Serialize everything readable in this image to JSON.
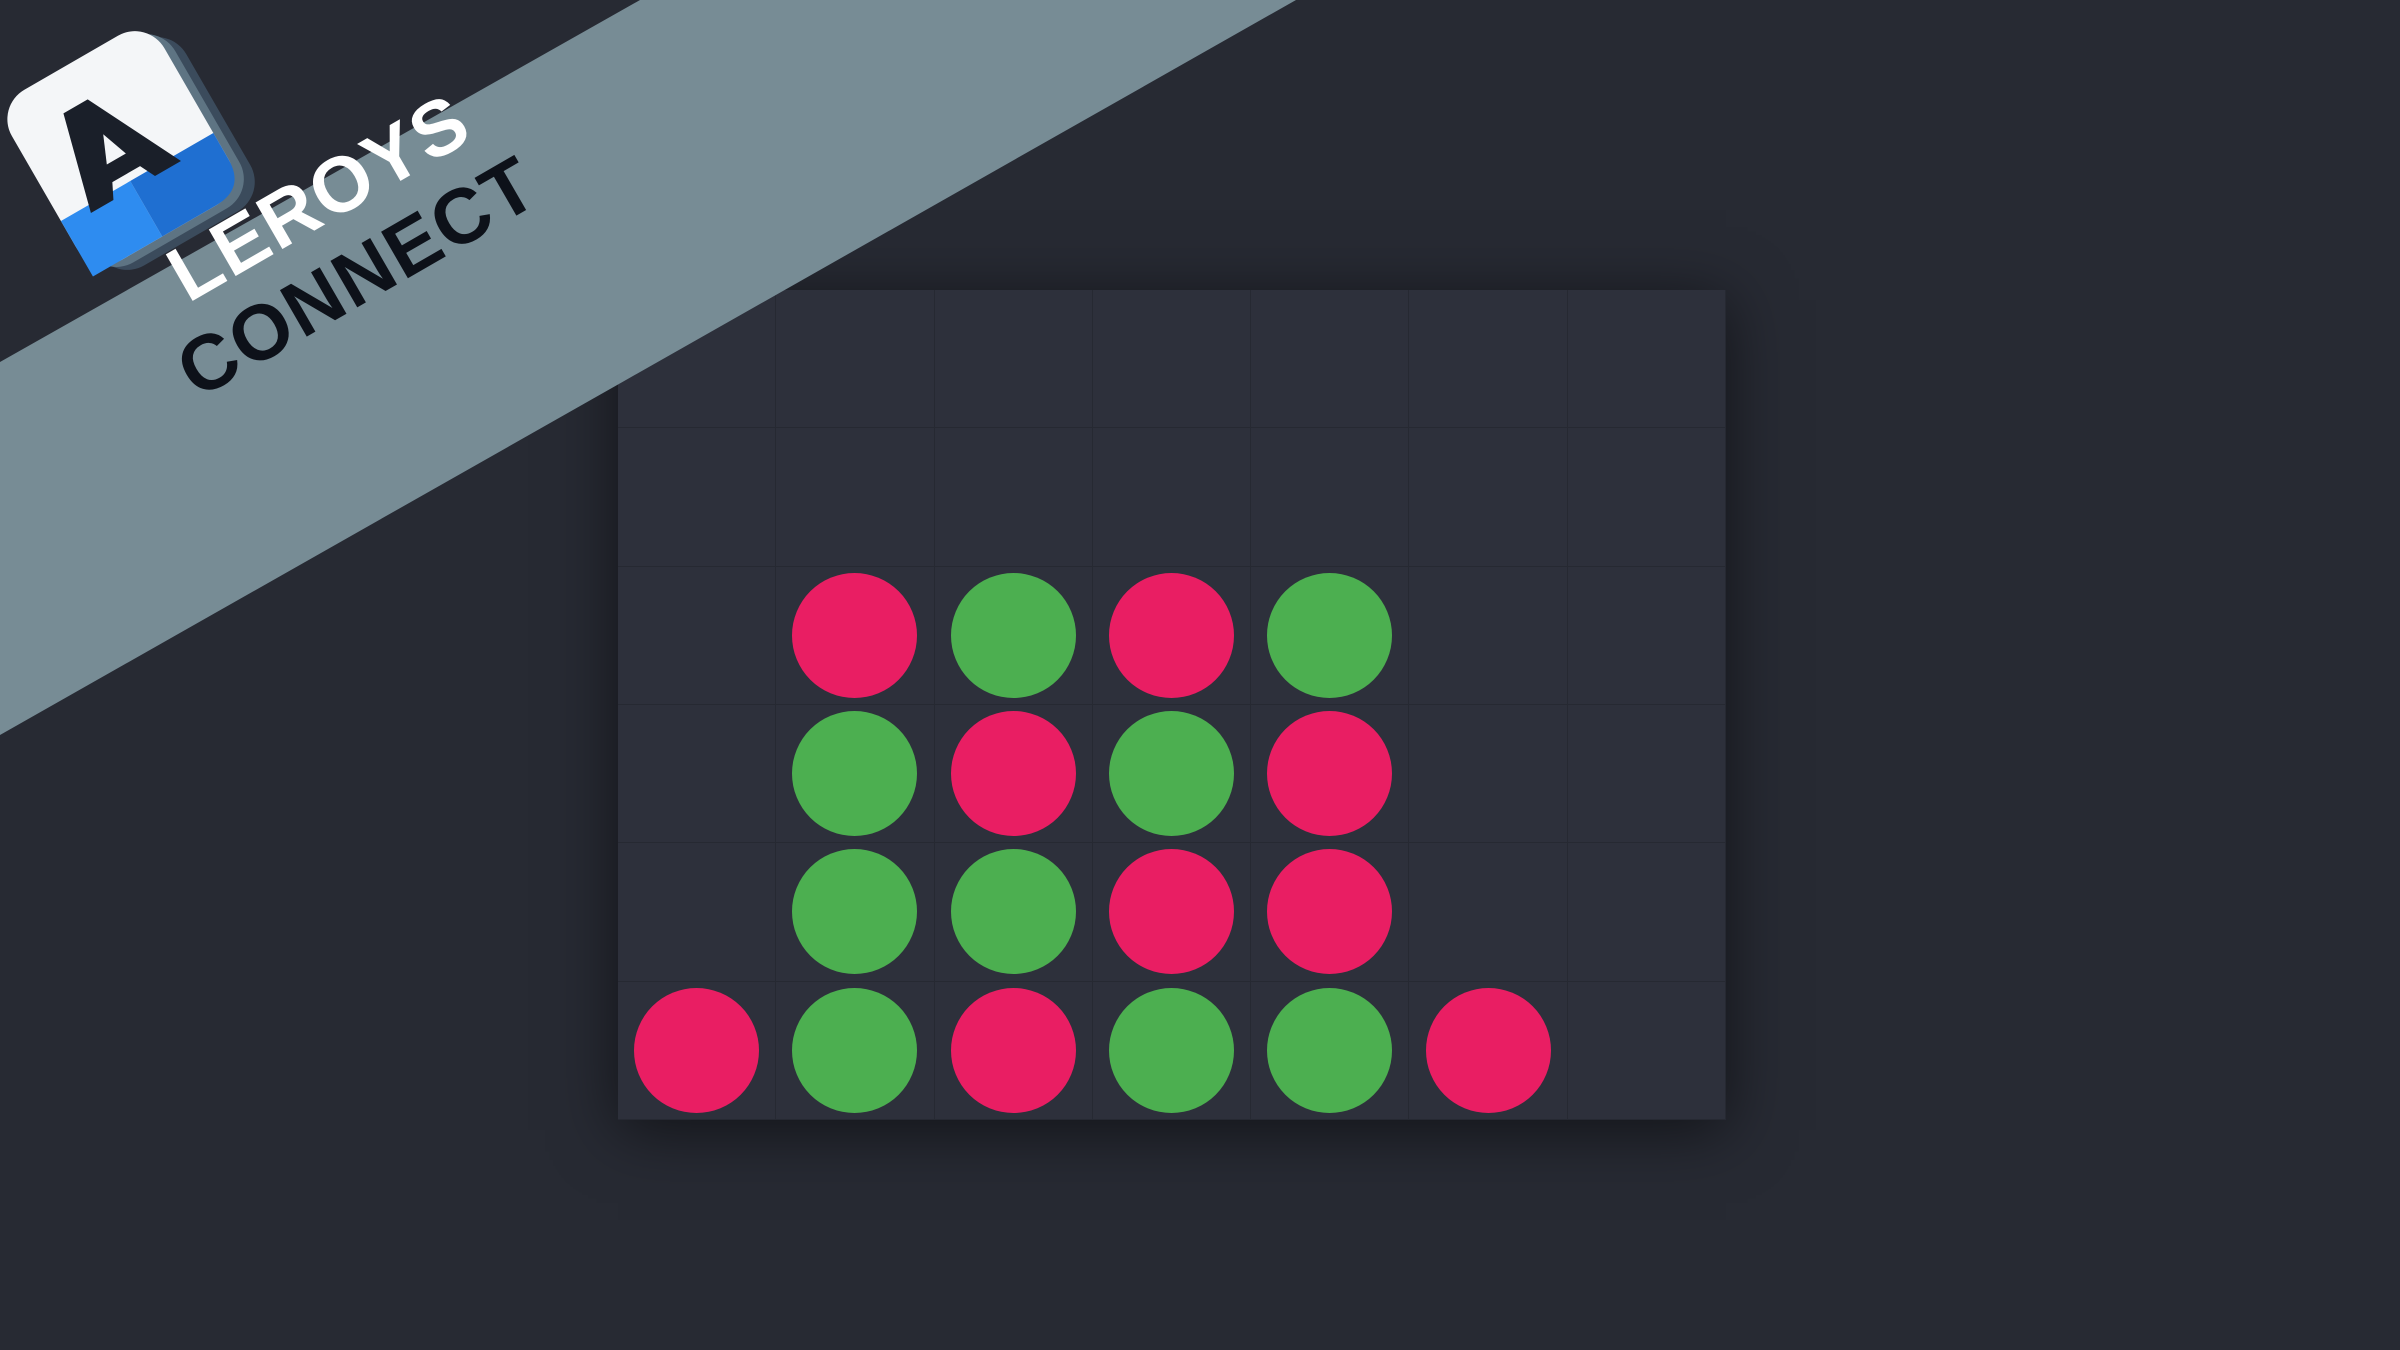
{
  "banner": {
    "title_line1": "LEROYS",
    "title_line2": "CONNECT",
    "background_color": "#778c95"
  },
  "icon": {
    "name": "leroys-connect-app-icon"
  },
  "board": {
    "columns": 7,
    "rows": 6,
    "background_color": "#2d303b",
    "colors": {
      "R": "#e91e63",
      "G": "#4caf50"
    },
    "grid": [
      [
        "",
        "",
        "",
        "",
        "",
        "",
        ""
      ],
      [
        "",
        "",
        "",
        "",
        "",
        "",
        ""
      ],
      [
        "",
        "R",
        "G",
        "R",
        "G",
        "",
        ""
      ],
      [
        "",
        "G",
        "R",
        "G",
        "R",
        "",
        ""
      ],
      [
        "",
        "G",
        "G",
        "R",
        "R",
        "",
        ""
      ],
      [
        "R",
        "G",
        "R",
        "G",
        "G",
        "R",
        ""
      ]
    ]
  }
}
